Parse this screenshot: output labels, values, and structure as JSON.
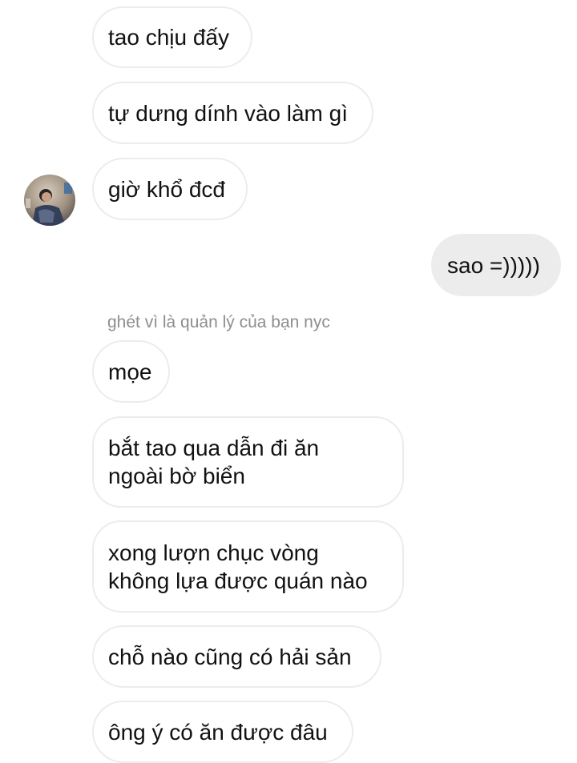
{
  "messages": [
    {
      "text": "tao chịu đấy",
      "from": "them"
    },
    {
      "text": "tự dưng dính vào làm gì",
      "from": "them"
    },
    {
      "text": "giờ khổ đcđ",
      "from": "them"
    },
    {
      "text": "sao =)))))",
      "from": "me"
    },
    {
      "text": "mọe",
      "from": "them"
    },
    {
      "text": "bắt tao qua dẫn đi ăn\nngoài bờ biển",
      "from": "them"
    },
    {
      "text": "xong lượn chục vòng\nkhông lựa được quán nào",
      "from": "them"
    },
    {
      "text": "chỗ nào cũng có hải sản",
      "from": "them"
    },
    {
      "text": "ông ý có ăn được đâu",
      "from": "them"
    }
  ],
  "reply_note": "ghét vì là quản lý của bạn nyc",
  "avatar_icon": "contact-avatar-photo",
  "colors": {
    "sent_bubble": "#ececec",
    "received_border": "#ececec",
    "note_text": "#8e8e8e"
  }
}
